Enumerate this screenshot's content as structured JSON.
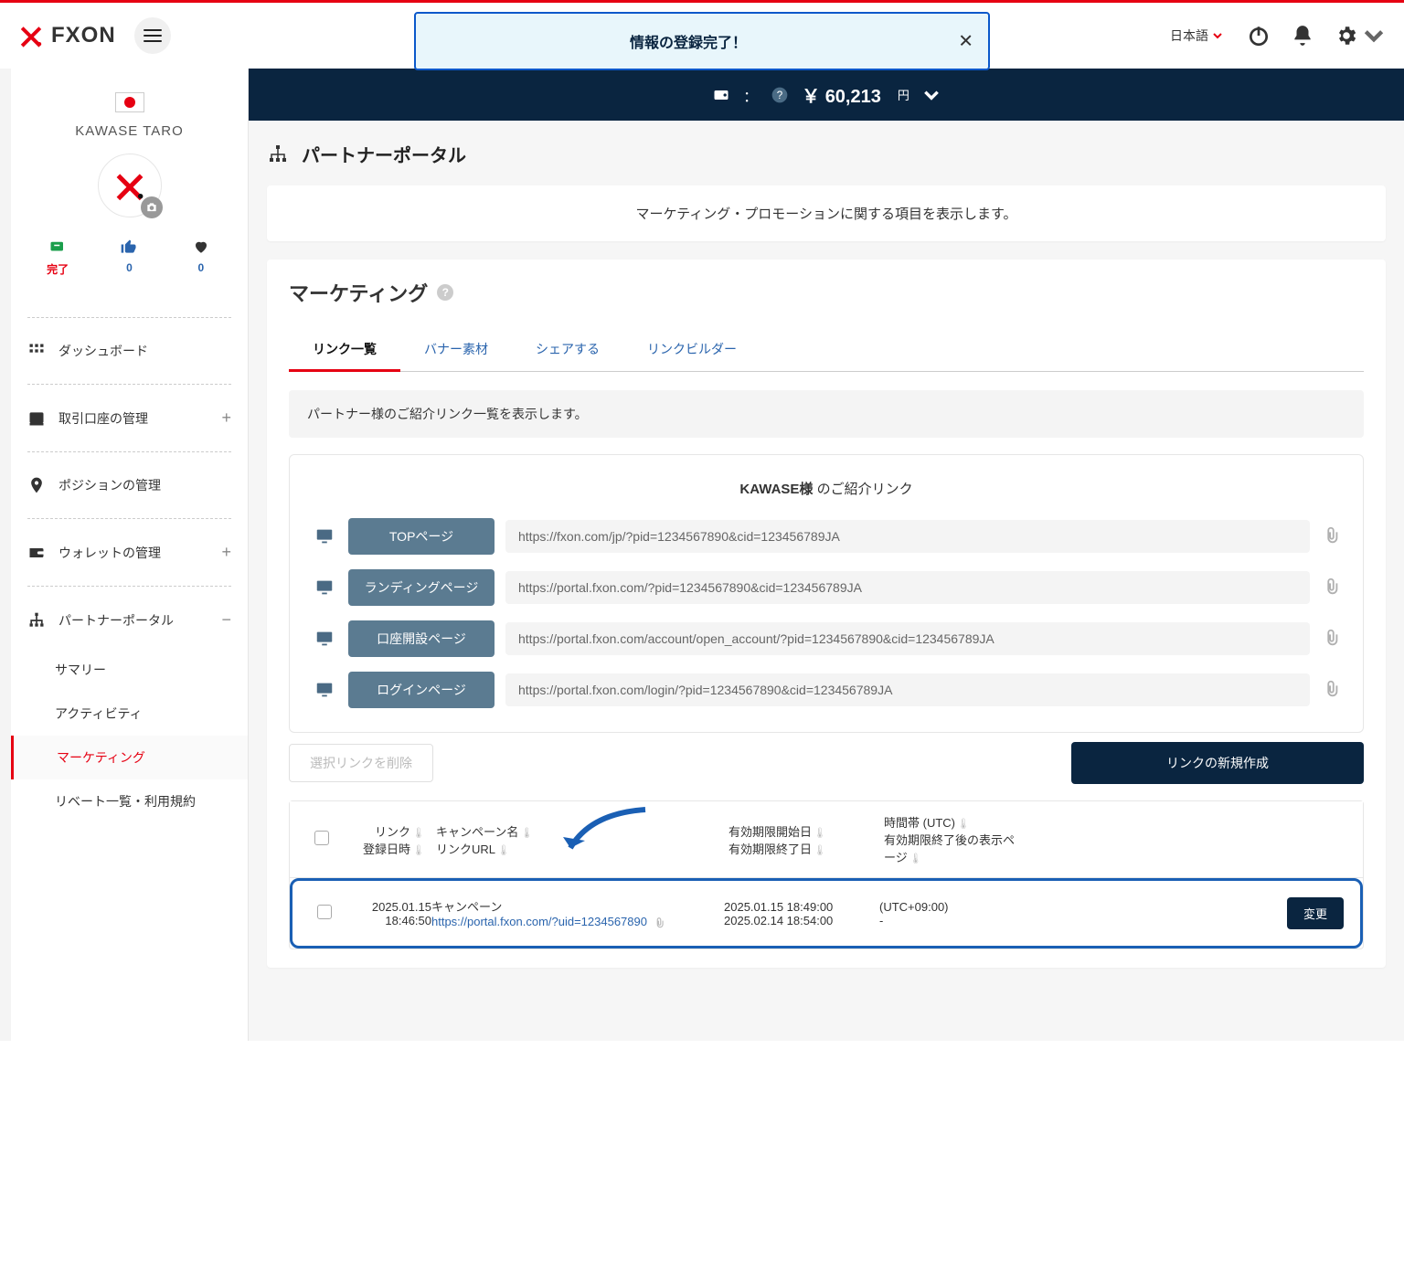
{
  "header": {
    "logo_text": "FXON",
    "language": "日本語"
  },
  "toast": {
    "message": "情報の登録完了！"
  },
  "profile": {
    "name": "KAWASE TARO",
    "stats": [
      {
        "label": "完了"
      },
      {
        "label": "0"
      },
      {
        "label": "0"
      }
    ]
  },
  "nav": {
    "dashboard": "ダッシュボード",
    "accounts": "取引口座の管理",
    "positions": "ポジションの管理",
    "wallet": "ウォレットの管理",
    "partner": "パートナーポータル",
    "sub": {
      "summary": "サマリー",
      "activity": "アクティビティ",
      "marketing": "マーケティング",
      "rebate": "リベート一覧・利用規約"
    }
  },
  "balance": {
    "symbol": "￥",
    "amount": "60,213",
    "unit": "円"
  },
  "page": {
    "title": "パートナーポータル",
    "info": "マーケティング・プロモーションに関する項目を表示します。",
    "section_title": "マーケティング"
  },
  "tabs": [
    "リンク一覧",
    "バナー素材",
    "シェアする",
    "リンクビルダー"
  ],
  "notice": "パートナー様のご紹介リンク一覧を表示します。",
  "referral": {
    "title_prefix": "KAWASE様",
    "title_suffix": " のご紹介リンク",
    "rows": [
      {
        "label": "TOPページ",
        "url": "https://fxon.com/jp/?pid=1234567890&cid=123456789JA"
      },
      {
        "label": "ランディングページ",
        "url": "https://portal.fxon.com/?pid=1234567890&cid=123456789JA"
      },
      {
        "label": "口座開設ページ",
        "url": "https://portal.fxon.com/account/open_account/?pid=1234567890&cid=123456789JA"
      },
      {
        "label": "ログインページ",
        "url": "https://portal.fxon.com/login/?pid=1234567890&cid=123456789JA"
      }
    ]
  },
  "actions": {
    "delete": "選択リンクを削除",
    "create": "リンクの新規作成"
  },
  "table": {
    "headers": {
      "date1": "リンク",
      "date2": "登録日時",
      "camp1": "キャンペーン名",
      "camp2": "リンクURL",
      "period1": "有効期限開始日",
      "period2": "有効期限終了日",
      "tz1": "時間帯 (UTC)",
      "tz2": "有効期限終了後の表示ページ"
    },
    "row": {
      "date1": "2025.01.15",
      "date2": "18:46:50",
      "campaign": "キャンペーン",
      "url": "https://portal.fxon.com/?uid=1234567890",
      "start": "2025.01.15 18:49:00",
      "end": "2025.02.14 18:54:00",
      "tz": "(UTC+09:00)",
      "after": "-",
      "change": "変更"
    }
  }
}
